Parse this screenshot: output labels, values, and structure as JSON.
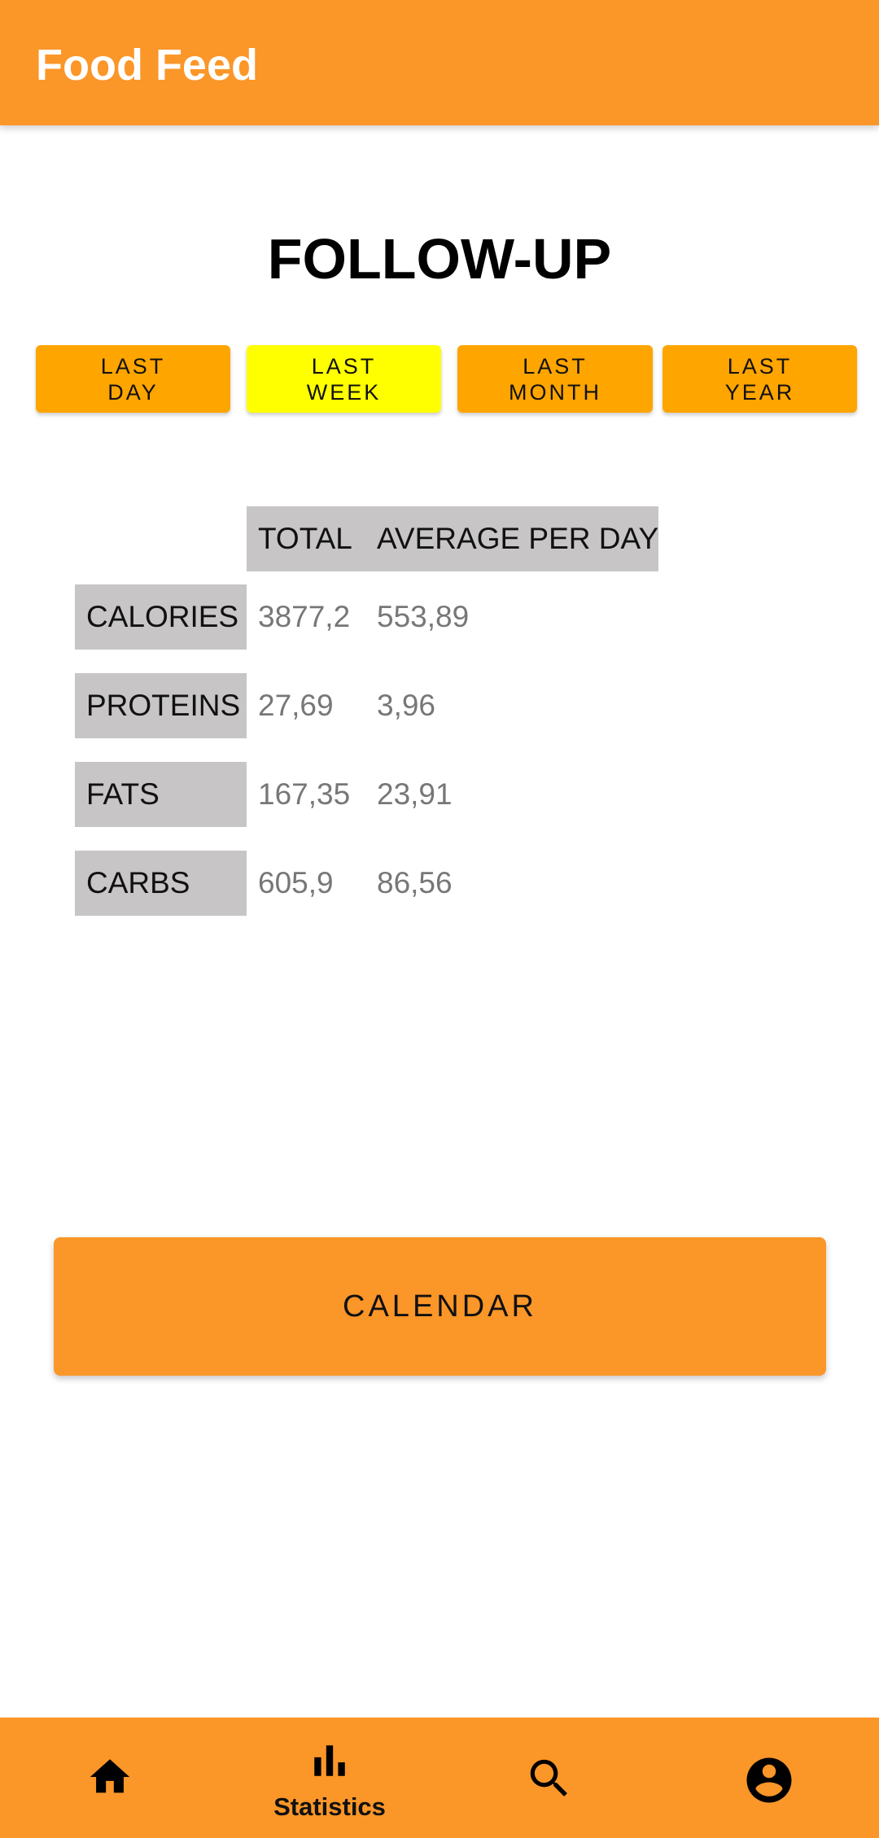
{
  "app_bar": {
    "title": "Food Feed"
  },
  "page_title": "FOLLOW-UP",
  "range_buttons": [
    {
      "label": "LAST\nDAY",
      "selected": false
    },
    {
      "label": "LAST\nWEEK",
      "selected": true
    },
    {
      "label": "LAST\nMONTH",
      "selected": false
    },
    {
      "label": "LAST\nYEAR",
      "selected": false
    }
  ],
  "table": {
    "headers": [
      "TOTAL",
      "AVERAGE PER DAY"
    ],
    "rows": [
      {
        "label": "CALORIES",
        "total": "3877,2",
        "average": "553,89"
      },
      {
        "label": "PROTEINS",
        "total": "27,69",
        "average": "3,96"
      },
      {
        "label": "FATS",
        "total": "167,35",
        "average": "23,91"
      },
      {
        "label": "CARBS",
        "total": "605,9",
        "average": "86,56"
      }
    ]
  },
  "calendar_button": {
    "label": "CALENDAR"
  },
  "bottom_nav": {
    "items": [
      {
        "icon": "home-icon",
        "label": ""
      },
      {
        "icon": "bar-chart-icon",
        "label": "Statistics"
      },
      {
        "icon": "search-icon",
        "label": ""
      },
      {
        "icon": "account-circle-icon",
        "label": ""
      }
    ],
    "selected_index": 1
  },
  "colors": {
    "app_bar": "#FB9628",
    "range_button": "#FFA500",
    "range_button_selected": "#FFFF00",
    "table_header_bg": "#C7C5C6",
    "value_text": "#777777"
  }
}
